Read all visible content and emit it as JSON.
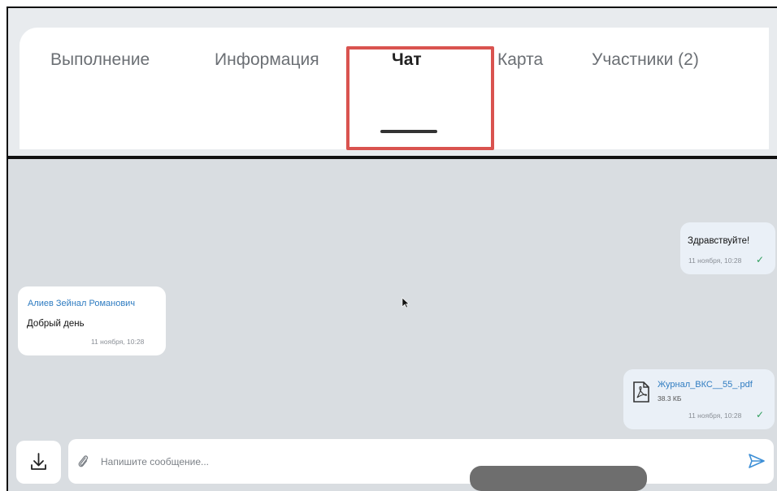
{
  "tabs": [
    {
      "label": "Выполнение"
    },
    {
      "label": "Информация"
    },
    {
      "label": "Чат",
      "active": true
    },
    {
      "label": "Карта"
    },
    {
      "label": "Участники (2)"
    }
  ],
  "messages": [
    {
      "direction": "outgoing",
      "text": "Здравствуйте!",
      "time": "11 ноября, 10:28",
      "status": "✓"
    },
    {
      "direction": "incoming",
      "sender": "Алиев Зейнал Романович",
      "text": "Добрый день",
      "time": "11 ноября, 10:28"
    },
    {
      "direction": "outgoing",
      "type": "file",
      "file_name": "Журнал_ВКС__55_.pdf",
      "file_size": "38.3 КБ",
      "time": "11 ноября, 10:28",
      "status": "✓"
    }
  ],
  "composer": {
    "placeholder": "Напишите сообщение..."
  },
  "colors": {
    "highlight": "#d9534f",
    "link": "#2f7cc1",
    "check": "#2e9e5b",
    "chat_bg": "#d9dde1"
  },
  "icons": [
    "download-icon",
    "paperclip-icon",
    "send-icon",
    "pdf-file-icon",
    "mouse-cursor-icon"
  ]
}
